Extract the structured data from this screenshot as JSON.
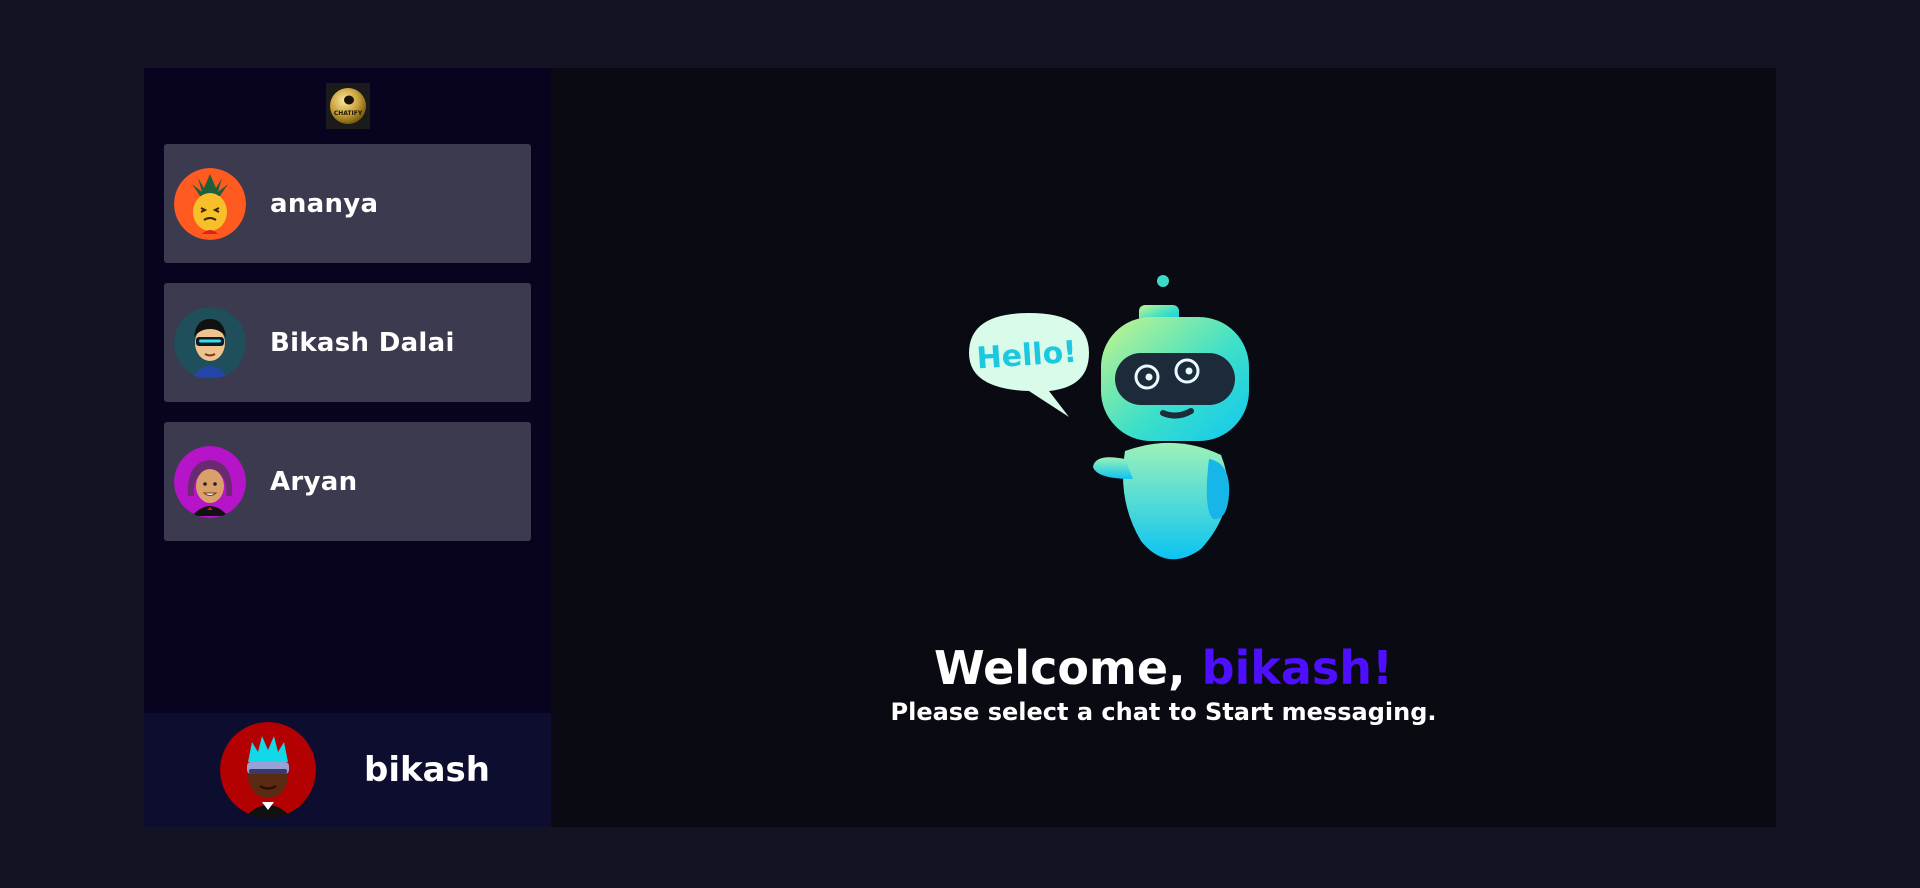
{
  "brand": {
    "logo_text": "CHATIFY"
  },
  "contacts": [
    {
      "name": "ananya",
      "avatar_bg": "#ff5a1f"
    },
    {
      "name": "Bikash Dalai",
      "avatar_bg": "#1e4f5a"
    },
    {
      "name": "Aryan",
      "avatar_bg": "#b514c9"
    }
  ],
  "current_user": {
    "name": "bikash",
    "avatar_bg": "#b30000"
  },
  "welcome": {
    "greeting": "Welcome, ",
    "username": "bikash!",
    "subtitle": "Please select a chat to Start messaging."
  },
  "robot": {
    "bubble_text": "Hello!"
  },
  "colors": {
    "page_bg": "#131324",
    "sidebar_bg": "#080420",
    "contact_bg": "#3c3a4f",
    "current_user_bg": "#0d0d30",
    "accent": "#4e0eff"
  }
}
